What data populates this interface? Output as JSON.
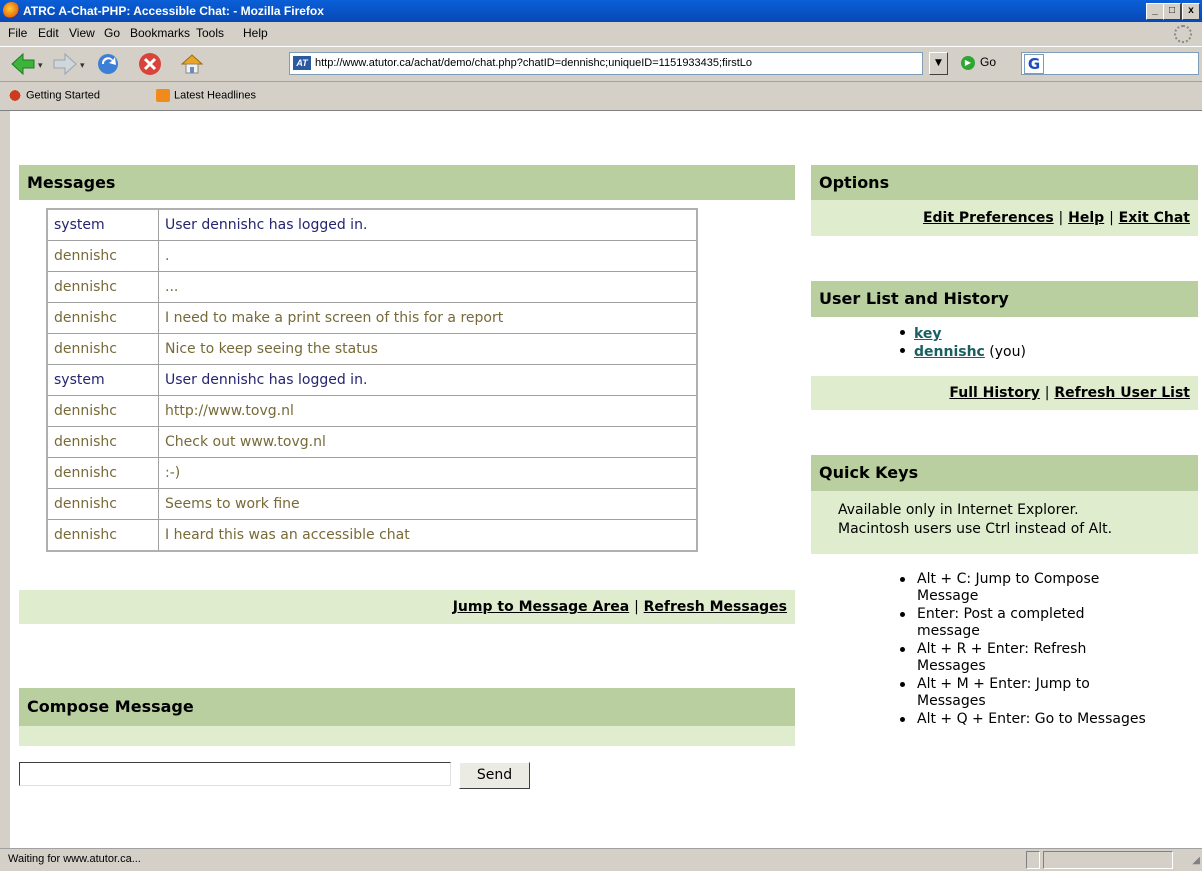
{
  "window": {
    "title": "ATRC A-Chat-PHP: Accessible Chat: - Mozilla Firefox",
    "min_label": "_",
    "max_label": "□",
    "close_label": "x"
  },
  "menu": [
    "File",
    "Edit",
    "View",
    "Go",
    "Bookmarks",
    "Tools",
    "Help"
  ],
  "navbar": {
    "url": "http://www.atutor.ca/achat/demo/chat.php?chatID=dennishc;uniqueID=1151933435;firstLo",
    "go_label": "Go",
    "search_logo": "G"
  },
  "bookmarks": [
    {
      "label": "Getting Started",
      "icon": "firefox-bookmark-icon"
    },
    {
      "label": "Latest Headlines",
      "icon": "rss-icon"
    }
  ],
  "messages": {
    "heading": "Messages",
    "rows": [
      {
        "user": "system",
        "text": "User dennishc has logged in.",
        "kind": "sys"
      },
      {
        "user": "dennishc",
        "text": ".",
        "kind": "usr"
      },
      {
        "user": "dennishc",
        "text": "...",
        "kind": "usr"
      },
      {
        "user": "dennishc",
        "text": "I need to make a print screen of this for a report",
        "kind": "usr"
      },
      {
        "user": "dennishc",
        "text": "Nice to keep seeing the status",
        "kind": "usr"
      },
      {
        "user": "system",
        "text": "User dennishc has logged in.",
        "kind": "sys"
      },
      {
        "user": "dennishc",
        "text": "http://www.tovg.nl",
        "kind": "usr"
      },
      {
        "user": "dennishc",
        "text": "Check out www.tovg.nl",
        "kind": "usr"
      },
      {
        "user": "dennishc",
        "text": ":-)",
        "kind": "usr"
      },
      {
        "user": "dennishc",
        "text": "Seems to work fine",
        "kind": "usr"
      },
      {
        "user": "dennishc",
        "text": "I heard this was an accessible chat",
        "kind": "usr"
      }
    ],
    "jump_label": "Jump to Message Area",
    "sep": "|",
    "refresh_label": "Refresh Messages"
  },
  "compose": {
    "heading": "Compose Message",
    "input_value": "",
    "send_label": "Send"
  },
  "options": {
    "heading": "Options",
    "edit_label": "Edit Preferences",
    "help_label": "Help",
    "exit_label": "Exit Chat",
    "sep": "|"
  },
  "userlist": {
    "heading": "User List and History",
    "users": [
      {
        "name": "key",
        "suffix": ""
      },
      {
        "name": "dennishc",
        "suffix": " (you)"
      }
    ],
    "history_label": "Full History",
    "refresh_label": "Refresh User List",
    "sep": "|"
  },
  "quickkeys": {
    "heading": "Quick Keys",
    "note_line1": "Available only in Internet Explorer.",
    "note_line2": "Macintosh users use Ctrl instead of Alt.",
    "items": [
      "Alt + C: Jump to Compose Message",
      "Enter: Post a completed message",
      "Alt + R + Enter: Refresh Messages",
      "Alt + M + Enter: Jump to Messages",
      "Alt + Q + Enter: Go to Messages"
    ]
  },
  "status": {
    "text": "Waiting for www.atutor.ca..."
  },
  "colors": {
    "section_header": "#b9cf9f",
    "section_strip": "#dfeccd",
    "system_text": "#242470",
    "user_text": "#776a38"
  }
}
